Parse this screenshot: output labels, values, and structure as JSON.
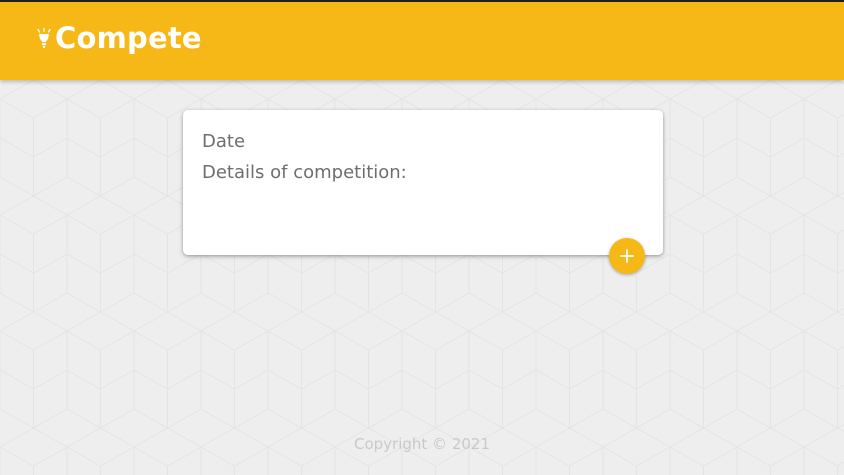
{
  "app": {
    "title": "Compete",
    "logo_icon": "lightbulb-icon"
  },
  "card": {
    "date_label": "Date",
    "details_label": "Details of competition:"
  },
  "actions": {
    "add_icon": "plus-icon"
  },
  "footer": {
    "copyright": "Copyright © 2021"
  },
  "colors": {
    "accent": "#f5b817",
    "background": "#eeeeee",
    "card": "#ffffff",
    "text_muted": "#6e6e6e",
    "footer_text": "#c9c9c9"
  }
}
